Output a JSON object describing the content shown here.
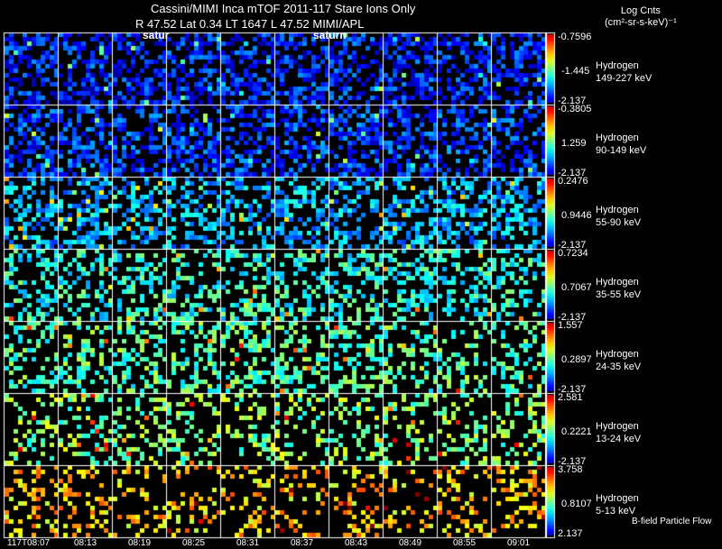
{
  "header": {
    "title": "Cassini/MIMI Inca mTOF  2011-117   Stare   Ions Only",
    "subtitle": "R          47.52 Lat 0.34 LT 1647 L          47.52  MIMI/APL",
    "saturn_markers": [
      "satur",
      "saturn"
    ]
  },
  "colorbar_units": {
    "line1": "Log Cnts",
    "line2": "(cm²-sr-s-keV)⁻¹"
  },
  "chart_data": {
    "type": "heatmap",
    "title": "Cassini/MIMI Inca mTOF  2011-117   Stare   Ions Only",
    "x_tick_labels": [
      "117T08:07",
      "08:13",
      "08:19",
      "08:25",
      "08:31",
      "08:37",
      "08:43",
      "08:49",
      "08:55",
      "09:01"
    ],
    "colormap": "rainbow (blue-cyan-green-yellow-red)",
    "rows": [
      {
        "species": "Hydrogen",
        "energy": "149-227 keV",
        "cb_max": "-0.7596",
        "cb_mid": "-1.445",
        "cb_min": "-2.137",
        "dominant_level": 0.15
      },
      {
        "species": "Hydrogen",
        "energy": "90-149 keV",
        "cb_max": "-0.3805",
        "cb_mid": "1.259",
        "cb_min": "-2.137",
        "dominant_level": 0.18
      },
      {
        "species": "Hydrogen",
        "energy": "55-90 keV",
        "cb_max": "0.2476",
        "cb_mid": "0.9446",
        "cb_min": "-2.137",
        "dominant_level": 0.3
      },
      {
        "species": "Hydrogen",
        "energy": "35-55 keV",
        "cb_max": "0.7234",
        "cb_mid": "0.7067",
        "cb_min": "-2.137",
        "dominant_level": 0.4
      },
      {
        "species": "Hydrogen",
        "energy": "24-35 keV",
        "cb_max": "1.557",
        "cb_mid": "0.2897",
        "cb_min": "-2.137",
        "dominant_level": 0.45
      },
      {
        "species": "Hydrogen",
        "energy": "13-24 keV",
        "cb_max": "2.581",
        "cb_mid": "0.2221",
        "cb_min": "-2.137",
        "dominant_level": 0.5
      },
      {
        "species": "Hydrogen",
        "energy": "5-13 keV",
        "cb_max": "3.758",
        "cb_mid": "0.8107",
        "cb_min": "2.137",
        "dominant_level": 0.68
      }
    ],
    "legend_note": "B-field Particle Flow"
  }
}
